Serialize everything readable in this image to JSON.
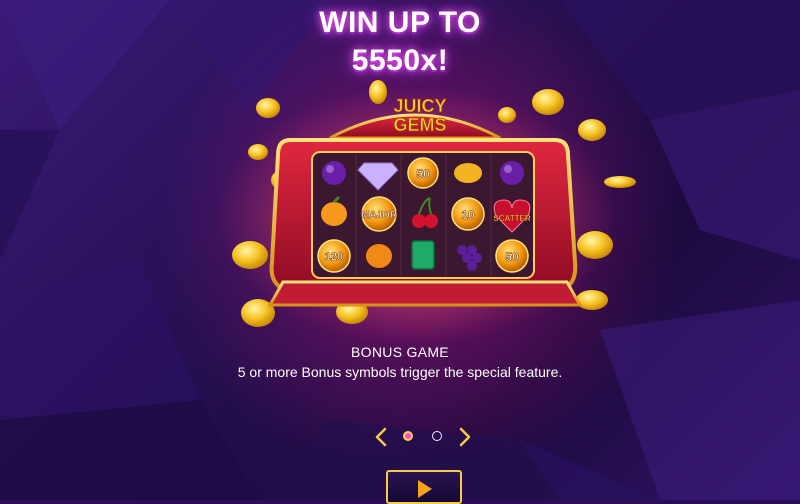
{
  "headline": {
    "line1": "WIN UP TO",
    "line2": "5550x!"
  },
  "logo": {
    "line1": "JUICY",
    "line2": "GEMS"
  },
  "reels": {
    "rows": [
      [
        "plum",
        "diamond",
        "coin-50",
        "lemon",
        "plum"
      ],
      [
        "orange",
        "coin-major",
        "cherries",
        "coin-10",
        "scatter"
      ],
      [
        "coin-120",
        "orange",
        "emerald",
        "grapes",
        "coin-50"
      ]
    ],
    "labels": {
      "coin_50_a": "50",
      "coin_major": "MAJOR",
      "coin_10": "10",
      "scatter": "SCATTER",
      "coin_120": "120",
      "coin_50_b": "50"
    }
  },
  "info": {
    "title": "BONUS GAME",
    "text": "5 or more Bonus symbols trigger the special feature."
  },
  "pager": {
    "pages": 2,
    "current": 1
  },
  "colors": {
    "accent_gold": "#f7c948",
    "active_dot": "#ff4fd6",
    "frame_red": "#b3122e"
  }
}
